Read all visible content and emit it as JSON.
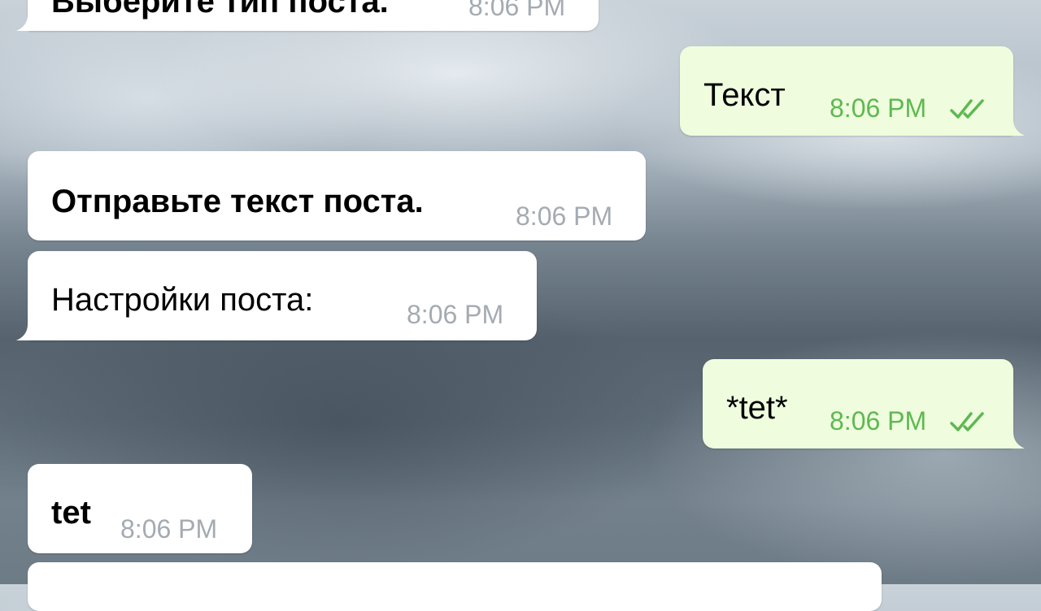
{
  "messages": [
    {
      "id": "m0",
      "direction": "incoming",
      "text": "Выберите тип поста.",
      "time": "8:06 PM",
      "bold": true
    },
    {
      "id": "m1",
      "direction": "outgoing",
      "text": "Текст",
      "time": "8:06 PM",
      "status": "read"
    },
    {
      "id": "m2",
      "direction": "incoming",
      "text": "Отправьте текст поста.",
      "time": "8:06 PM",
      "bold": true
    },
    {
      "id": "m3",
      "direction": "incoming",
      "text": "Настройки поста:",
      "time": "8:06 PM",
      "bold": false
    },
    {
      "id": "m4",
      "direction": "outgoing",
      "text": "*tet*",
      "time": "8:06 PM",
      "status": "read"
    },
    {
      "id": "m5",
      "direction": "incoming",
      "text": "tet",
      "time": "8:06 PM",
      "bold": true
    }
  ],
  "colors": {
    "incoming_bubble": "#ffffff",
    "outgoing_bubble": "#effdde",
    "incoming_time": "#a4abb2",
    "outgoing_time": "#5fb852",
    "read_checks": "#5fb852"
  },
  "icons": {
    "read_status": "double-check-icon"
  }
}
